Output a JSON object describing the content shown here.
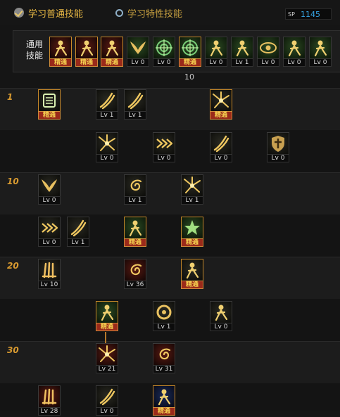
{
  "tabs": [
    {
      "label": "学习普通技能",
      "active": true
    },
    {
      "label": "学习特性技能",
      "active": false
    }
  ],
  "sp": {
    "label": "SP",
    "value": "1145"
  },
  "common": {
    "label": "通用技能",
    "skills": [
      {
        "name": "common-skill-1",
        "level": "精通",
        "master": true,
        "icon": "figure"
      },
      {
        "name": "common-skill-2",
        "level": "精通",
        "master": true,
        "icon": "figure"
      },
      {
        "name": "common-skill-3",
        "level": "精通",
        "master": true,
        "icon": "figure"
      },
      {
        "name": "common-skill-4",
        "level": "Lv 0",
        "master": false,
        "icon": "wing"
      },
      {
        "name": "common-skill-5",
        "level": "Lv 0",
        "master": false,
        "icon": "target"
      },
      {
        "name": "common-skill-6",
        "level": "精通",
        "master": true,
        "icon": "target"
      },
      {
        "name": "common-skill-7",
        "level": "Lv 0",
        "master": false,
        "icon": "figure"
      },
      {
        "name": "common-skill-8",
        "level": "Lv 1",
        "master": false,
        "icon": "figure"
      },
      {
        "name": "common-skill-9",
        "level": "Lv 0",
        "master": false,
        "icon": "eye"
      },
      {
        "name": "common-skill-10",
        "level": "Lv 0",
        "master": false,
        "icon": "figure"
      },
      {
        "name": "common-skill-11",
        "level": "Lv 0",
        "master": false,
        "icon": "figure"
      }
    ],
    "marker": "10"
  },
  "level_labels": [
    "1",
    "10",
    "20",
    "30"
  ],
  "tree": [
    {
      "name": "skill-r1-a",
      "level": "精通",
      "master": true,
      "icon": "dark",
      "tier": 0
    },
    {
      "name": "skill-r1-b",
      "level": "Lv 1",
      "master": false,
      "icon": "slash",
      "tier": 0
    },
    {
      "name": "skill-r1-c",
      "level": "Lv 1",
      "master": false,
      "icon": "slash",
      "tier": 0
    },
    {
      "name": "skill-r1-d",
      "level": "精通",
      "master": true,
      "icon": "burst",
      "tier": 0
    },
    {
      "name": "skill-r2-a",
      "level": "Lv 0",
      "master": false,
      "icon": "burst",
      "tier": 0
    },
    {
      "name": "skill-r2-b",
      "level": "Lv 0",
      "master": false,
      "icon": "arrows",
      "tier": 0
    },
    {
      "name": "skill-r2-c",
      "level": "Lv 0",
      "master": false,
      "icon": "slash",
      "tier": 0
    },
    {
      "name": "skill-r2-d",
      "level": "Lv 0",
      "master": false,
      "icon": "shield",
      "tier": 0
    },
    {
      "name": "skill-r3-a",
      "level": "Lv 0",
      "master": false,
      "icon": "wing",
      "tier": 0
    },
    {
      "name": "skill-r3-b",
      "level": "Lv 1",
      "master": false,
      "icon": "swirl",
      "tier": 0
    },
    {
      "name": "skill-r3-c",
      "level": "Lv 1",
      "master": false,
      "icon": "burst",
      "tier": 0
    },
    {
      "name": "skill-r4-a",
      "level": "Lv 0",
      "master": false,
      "icon": "arrows",
      "tier": 0
    },
    {
      "name": "skill-r4-b",
      "level": "Lv 1",
      "master": false,
      "icon": "slash",
      "tier": 0
    },
    {
      "name": "skill-r4-c",
      "level": "精通",
      "master": true,
      "icon": "figure",
      "tier": 1
    },
    {
      "name": "skill-r4-d",
      "level": "精通",
      "master": true,
      "icon": "star",
      "tier": 1
    },
    {
      "name": "skill-r5-a",
      "level": "Lv 10",
      "master": false,
      "icon": "claw",
      "tier": 0
    },
    {
      "name": "skill-r5-b",
      "level": "Lv 36",
      "master": false,
      "icon": "swirl",
      "tier": 2
    },
    {
      "name": "skill-r5-c",
      "level": "精通",
      "master": true,
      "icon": "figure",
      "tier": 0
    },
    {
      "name": "skill-r6-a",
      "level": "精通",
      "master": true,
      "icon": "figure",
      "tier": 1
    },
    {
      "name": "skill-r6-b",
      "level": "Lv 1",
      "master": false,
      "icon": "ring",
      "tier": 0
    },
    {
      "name": "skill-r6-c",
      "level": "Lv 0",
      "master": false,
      "icon": "figure",
      "tier": 0
    },
    {
      "name": "skill-r7-a",
      "level": "Lv 21",
      "master": false,
      "icon": "burst",
      "tier": 2
    },
    {
      "name": "skill-r7-b",
      "level": "Lv 31",
      "master": false,
      "icon": "swirl",
      "tier": 2
    },
    {
      "name": "skill-r8-a",
      "level": "Lv 28",
      "master": false,
      "icon": "claw",
      "tier": 2
    },
    {
      "name": "skill-r8-b",
      "level": "Lv 0",
      "master": false,
      "icon": "slash",
      "tier": 0
    },
    {
      "name": "skill-r8-c",
      "level": "精通",
      "master": true,
      "icon": "figure",
      "tier": 3
    }
  ],
  "colors": {
    "accent": "#e8b844",
    "sp_value": "#38a8e8",
    "master_bg": "#9a2a1a",
    "level_label": "#d89a30"
  }
}
